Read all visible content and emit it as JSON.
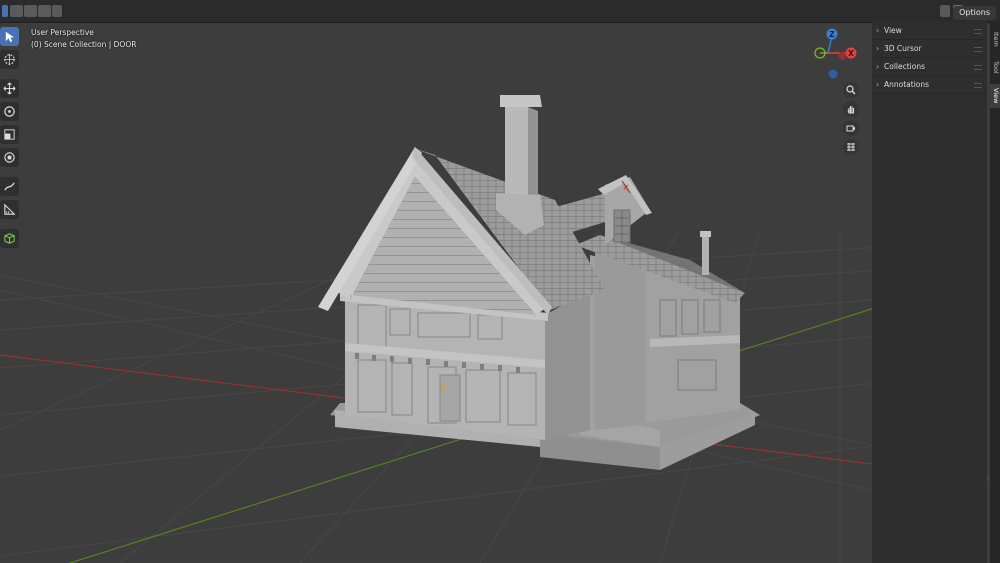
{
  "viewport": {
    "view_name": "User Perspective",
    "collection_info": "(0) Scene Collection | DOOR",
    "options_label": "Options"
  },
  "toolbar": {
    "tools": [
      {
        "name": "select-box-tool",
        "icon": "cursor-arrow-icon",
        "active": true
      },
      {
        "name": "cursor-tool",
        "icon": "3d-cursor-icon",
        "active": false
      },
      {
        "name": "move-tool",
        "icon": "move-arrows-icon",
        "active": false
      },
      {
        "name": "rotate-tool",
        "icon": "rotate-icon",
        "active": false
      },
      {
        "name": "scale-tool",
        "icon": "scale-icon",
        "active": false
      },
      {
        "name": "transform-tool",
        "icon": "transform-icon",
        "active": false
      },
      {
        "name": "annotate-tool",
        "icon": "pencil-icon",
        "active": false
      },
      {
        "name": "measure-tool",
        "icon": "ruler-icon",
        "active": false
      },
      {
        "name": "add-cube-tool",
        "icon": "cube-add-icon",
        "active": false
      }
    ]
  },
  "sidebar": {
    "categories": [
      {
        "label": "View"
      },
      {
        "label": "3D Cursor"
      },
      {
        "label": "Collections"
      },
      {
        "label": "Annotations"
      }
    ],
    "tabs": [
      {
        "label": "Item",
        "active": false
      },
      {
        "label": "Tool",
        "active": false
      },
      {
        "label": "View",
        "active": true
      }
    ]
  },
  "gizmo": {
    "axes": {
      "x": "X",
      "y": "Y",
      "z": "Z"
    },
    "colors": {
      "x": "#e0433f",
      "y": "#7dbb2a",
      "z": "#3a7fd6"
    }
  },
  "nav_buttons": [
    {
      "name": "zoom-button",
      "icon": "magnifier-icon"
    },
    {
      "name": "pan-button",
      "icon": "hand-icon"
    },
    {
      "name": "camera-view-button",
      "icon": "camera-icon"
    },
    {
      "name": "ortho-toggle-button",
      "icon": "grid-icon"
    }
  ],
  "colors": {
    "viewport_bg": "#3d3d3d",
    "grid_line": "#4a4a4a",
    "x_axis": "#9b3a3a",
    "y_axis": "#5e8b2a",
    "active_tool": "#4772b3",
    "model": "#a9a9a9"
  }
}
